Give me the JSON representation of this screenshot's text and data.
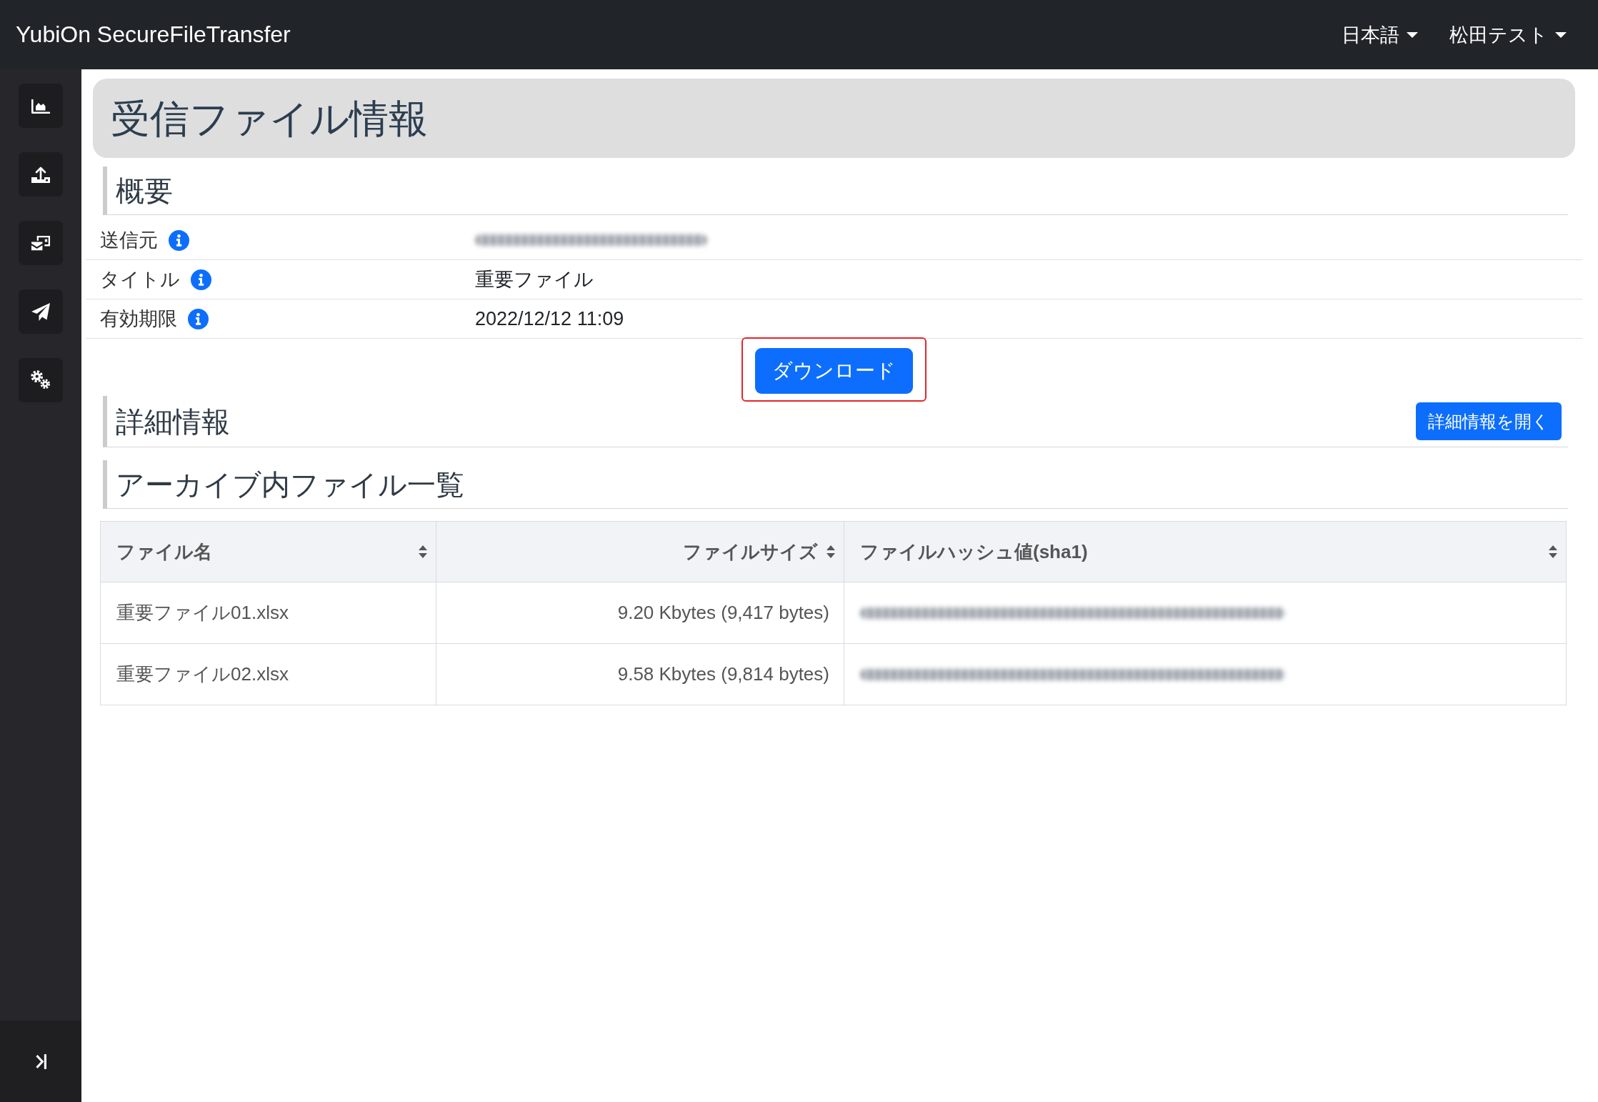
{
  "navbar": {
    "brand": "YubiOn SecureFileTransfer",
    "menus": [
      {
        "label": "日本語"
      },
      {
        "label": "松田テスト"
      }
    ]
  },
  "sidebar": {
    "items": [
      {
        "kind": "chart"
      },
      {
        "kind": "upload"
      },
      {
        "kind": "inbox"
      },
      {
        "kind": "send"
      },
      {
        "kind": "settings"
      }
    ]
  },
  "page_header": {
    "title": "受信ファイル情報"
  },
  "overview": {
    "heading": "概要",
    "rows": [
      {
        "label": "送信元",
        "redacted": true
      },
      {
        "label": "タイトル",
        "value": "重要ファイル",
        "redacted": false
      },
      {
        "label": "有効期限",
        "value": "2022/12/12 11:09",
        "redacted": false
      }
    ],
    "download_button": {
      "label": "ダウンロード",
      "highlighted": true
    }
  },
  "details": {
    "heading": "詳細情報",
    "button": {
      "label": "詳細情報を開く"
    }
  },
  "archive": {
    "heading": "アーカイブ内ファイル一覧",
    "table": {
      "columns": [
        "ファイル名",
        "ファイルサイズ",
        "ファイルハッシュ値(sha1)"
      ],
      "rows": [
        {
          "name": "重要ファイル01.xlsx",
          "size": "9.20 Kbytes (9,417 bytes)",
          "hash_redacted": true
        },
        {
          "name": "重要ファイル02.xlsx",
          "size": "9.58 Kbytes (9,814 bytes)",
          "hash_redacted": true
        }
      ]
    }
  }
}
